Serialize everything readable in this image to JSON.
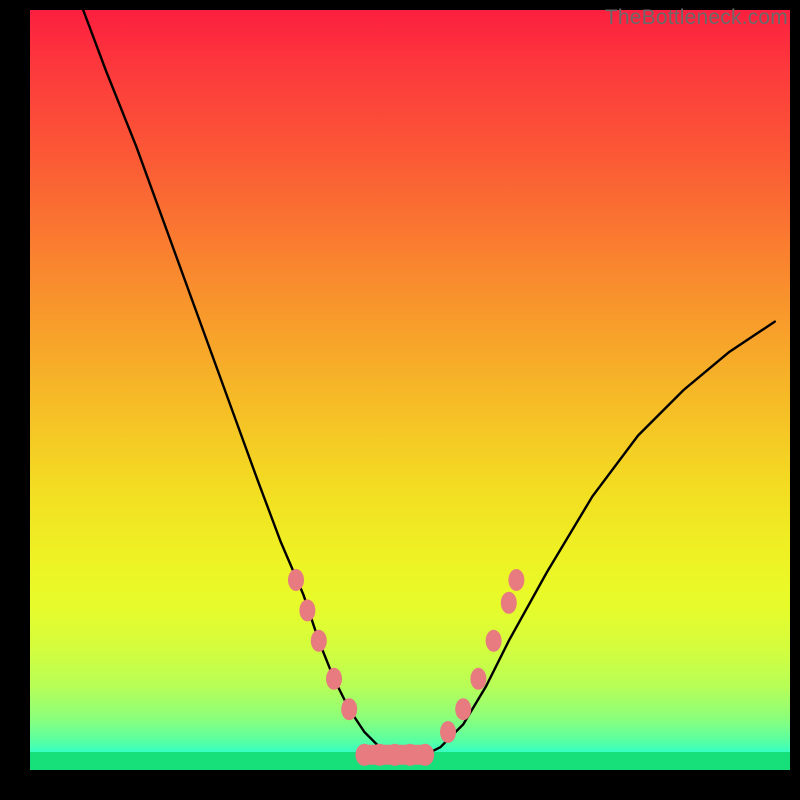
{
  "watermark": "TheBottleneck.com",
  "chart_data": {
    "type": "line",
    "title": "",
    "xlabel": "",
    "ylabel": "",
    "xlim": [
      0,
      100
    ],
    "ylim": [
      0,
      100
    ],
    "series": [
      {
        "name": "curve",
        "x": [
          7,
          10,
          14,
          18,
          22,
          26,
          30,
          33,
          36,
          38,
          40,
          42,
          44,
          46,
          48,
          50,
          52,
          54,
          57,
          60,
          63,
          68,
          74,
          80,
          86,
          92,
          98
        ],
        "y": [
          100,
          92,
          82,
          71,
          60,
          49,
          38,
          30,
          23,
          17,
          12,
          8,
          5,
          3,
          2,
          2,
          2,
          3,
          6,
          11,
          17,
          26,
          36,
          44,
          50,
          55,
          59
        ]
      }
    ],
    "markers": {
      "left": [
        [
          35,
          25
        ],
        [
          36.5,
          21
        ],
        [
          38,
          17
        ],
        [
          40,
          12
        ],
        [
          42,
          8
        ]
      ],
      "right": [
        [
          55,
          5
        ],
        [
          57,
          8
        ],
        [
          59,
          12
        ],
        [
          61,
          17
        ],
        [
          63,
          22
        ],
        [
          64,
          25
        ]
      ],
      "flat": [
        [
          44,
          2
        ],
        [
          46,
          2
        ],
        [
          48,
          2
        ],
        [
          50,
          2
        ],
        [
          52,
          2
        ]
      ]
    },
    "colors": {
      "curve": "#000000",
      "marker": "#e77b7f",
      "gradient_top": "#fc1f3f",
      "gradient_bottom": "#17e07a"
    }
  }
}
